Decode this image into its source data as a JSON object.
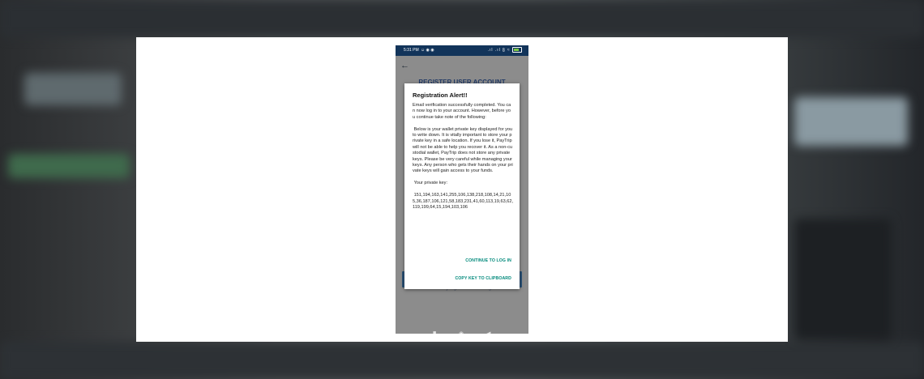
{
  "status_bar": {
    "time": "5:31 PM",
    "app_icons": "☺ ◉ ◉",
    "signal_icons": ".ıl .ıl ⩉ ≈",
    "battery": "100"
  },
  "app": {
    "title": "REGISTER USER ACCOUNT",
    "footer_text": "nouday.mgmuncurr.com.ng"
  },
  "dialog": {
    "title": "Registration Alert!!",
    "message": "Email verification successfully completed. You can now log in to your account. However, before you continue take note of the following:\n\n Below is your wallet private key displayed for you to write down. It is vitally important to store your private key in a safe location. If you lose it, PayTrip will not be able to help you recover it. As a non-custodial wallet, PayTrip does not store any private keys. Please be very careful while managing your keys. Any person who gets their hands on your private keys will gain access to your funds.\n\n Your private key:\n\n 151,194,163,141,255,106,138,218,108,14,21,105,36,187,106,121,58,183,231,41,60,113,19,63,62,119,199,64,15,194,103,106",
    "action_continue": "CONTINUE TO LOG IN",
    "action_copy": "COPY KEY TO CLIPBOARD"
  },
  "nav": {
    "recents": "■",
    "home": "◉",
    "back": "◀"
  },
  "colors": {
    "status_bar": "#12345a",
    "accent": "#00897b",
    "app_button": "#2b5276"
  }
}
